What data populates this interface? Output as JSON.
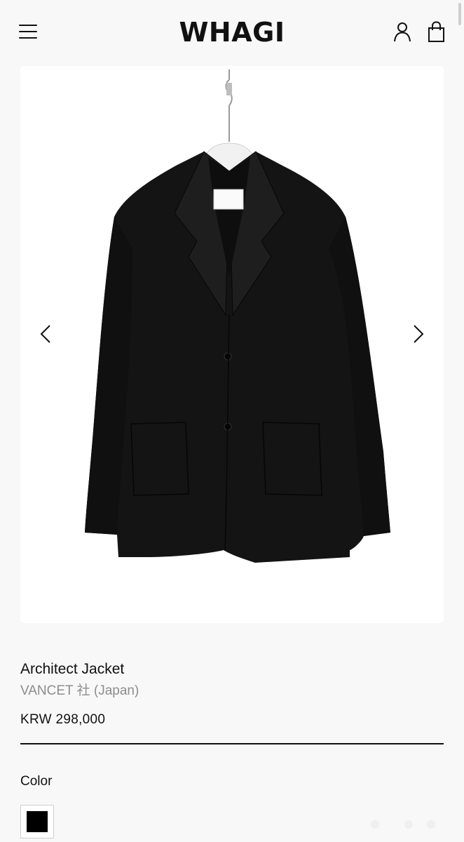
{
  "header": {
    "logo": "WHAGI",
    "menu_icon": "hamburger-menu-icon",
    "account_icon": "user-icon",
    "cart_icon": "shopping-bag-icon"
  },
  "gallery": {
    "image_subject": "black-blazer-on-hanger",
    "prev_icon": "chevron-left-icon",
    "next_icon": "chevron-right-icon"
  },
  "product": {
    "name": "Architect Jacket",
    "maker": "VANCET 社 (Japan)",
    "price": "KRW 298,000"
  },
  "options": {
    "color_label": "Color",
    "selected_color": "#000000"
  },
  "colors": {
    "background": "#f8f8f8",
    "text": "#111111",
    "muted_text": "#8d8d8d"
  }
}
